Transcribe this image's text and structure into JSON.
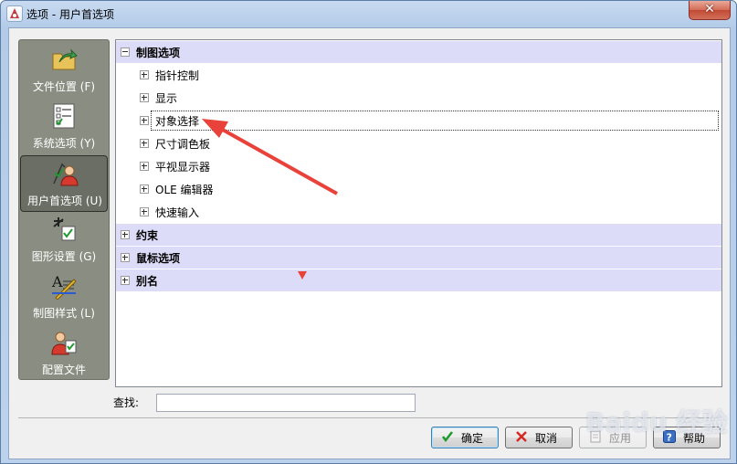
{
  "window": {
    "title": "选项 - 用户首选项",
    "close_icon": "close-icon"
  },
  "sidebar": {
    "items": [
      {
        "label": "文件位置 (F)",
        "icon": "folder-arrow-icon",
        "active": false
      },
      {
        "label": "系统选项 (Y)",
        "icon": "checklist-icon",
        "active": false
      },
      {
        "label": "用户首选项 (U)",
        "icon": "user-preferences-icon",
        "active": true
      },
      {
        "label": "图形设置 (G)",
        "icon": "graphics-settings-icon",
        "active": false
      },
      {
        "label": "制图样式 (L)",
        "icon": "drafting-style-icon",
        "active": false
      },
      {
        "label": "配置文件",
        "icon": "profile-user-icon",
        "active": false
      }
    ]
  },
  "tree": {
    "rows": [
      {
        "label": "制图选项",
        "level": 0,
        "expanded": true,
        "category": true
      },
      {
        "label": "指针控制",
        "level": 1,
        "expanded": false,
        "category": false
      },
      {
        "label": "显示",
        "level": 1,
        "expanded": false,
        "category": false
      },
      {
        "label": "对象选择",
        "level": 1,
        "expanded": false,
        "category": false,
        "focused": true
      },
      {
        "label": "尺寸调色板",
        "level": 1,
        "expanded": false,
        "category": false
      },
      {
        "label": "平视显示器",
        "level": 1,
        "expanded": false,
        "category": false
      },
      {
        "label": "OLE 编辑器",
        "level": 1,
        "expanded": false,
        "category": false
      },
      {
        "label": "快速输入",
        "level": 1,
        "expanded": false,
        "category": false
      },
      {
        "label": "约束",
        "level": 0,
        "expanded": false,
        "category": true
      },
      {
        "label": "鼠标选项",
        "level": 0,
        "expanded": false,
        "category": true
      },
      {
        "label": "别名",
        "level": 0,
        "expanded": false,
        "category": true
      }
    ]
  },
  "search": {
    "label": "查找:",
    "value": "",
    "placeholder": ""
  },
  "buttons": {
    "ok": "确定",
    "cancel": "取消",
    "apply": "应用",
    "help": "帮助"
  },
  "watermark": "Baidu 经验",
  "colors": {
    "category_bg": "#dcdcf8",
    "sidebar_bg": "#8a8e82",
    "annotation_red": "#e8423a"
  }
}
